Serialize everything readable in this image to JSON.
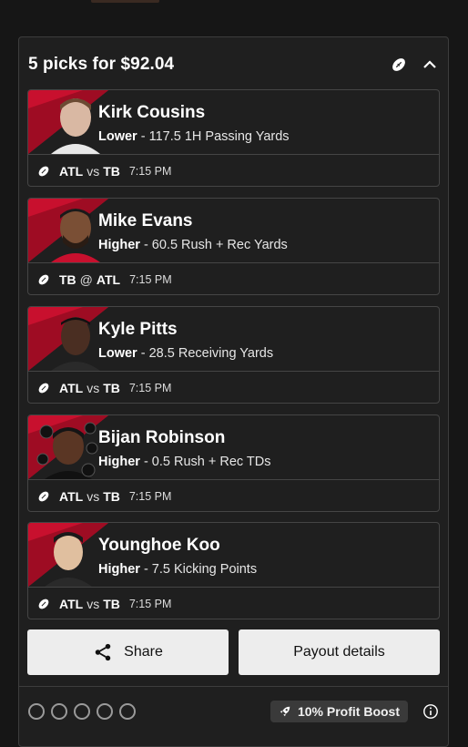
{
  "header": {
    "title": "5 picks for $92.04"
  },
  "picks": [
    {
      "player": "Kirk Cousins",
      "direction": "Lower",
      "line": "- 117.5 1H Passing Yards",
      "team_a": "ATL",
      "sep": "vs",
      "team_b": "TB",
      "time": "7:15 PM"
    },
    {
      "player": "Mike Evans",
      "direction": "Higher",
      "line": "- 60.5 Rush + Rec Yards",
      "team_a": "TB",
      "sep": "@",
      "team_b": "ATL",
      "time": "7:15 PM"
    },
    {
      "player": "Kyle Pitts",
      "direction": "Lower",
      "line": "- 28.5 Receiving Yards",
      "team_a": "ATL",
      "sep": "vs",
      "team_b": "TB",
      "time": "7:15 PM"
    },
    {
      "player": "Bijan Robinson",
      "direction": "Higher",
      "line": "- 0.5 Rush + Rec TDs",
      "team_a": "ATL",
      "sep": "vs",
      "team_b": "TB",
      "time": "7:15 PM"
    },
    {
      "player": "Younghoe Koo",
      "direction": "Higher",
      "line": "- 7.5 Kicking Points",
      "team_a": "ATL",
      "sep": "vs",
      "team_b": "TB",
      "time": "7:15 PM"
    }
  ],
  "actions": {
    "share_label": "Share",
    "payout_label": "Payout details"
  },
  "footer": {
    "boost_label": "10% Profit Boost"
  },
  "colors": {
    "accent_red": "#c8102e",
    "button_bg": "#ededed"
  },
  "icons": [
    "football-icon",
    "chevron-up-icon",
    "share-icon",
    "rocket-icon",
    "info-icon"
  ]
}
